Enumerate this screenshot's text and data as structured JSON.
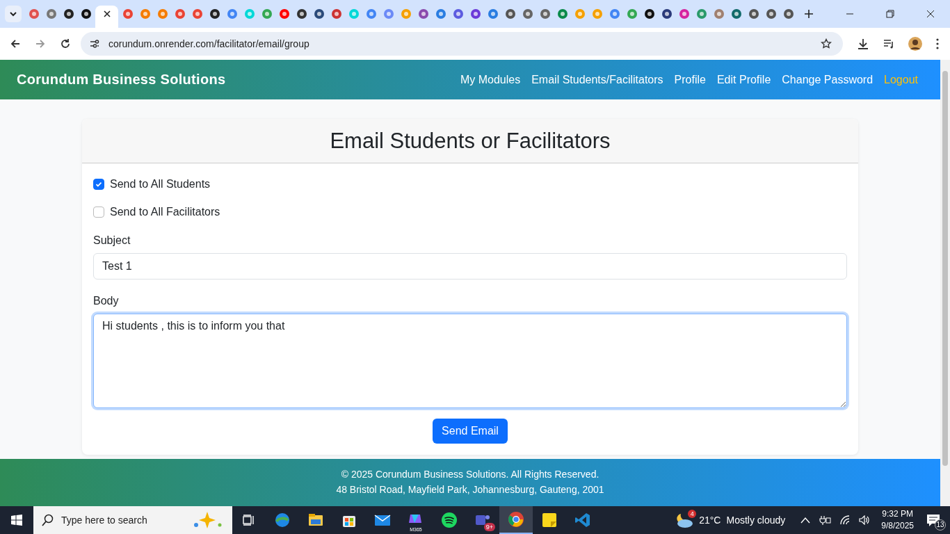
{
  "browser": {
    "tabs": [
      {
        "selected": false
      },
      {
        "selected": false
      },
      {
        "selected": false
      },
      {
        "selected": false
      },
      {
        "selected": true
      },
      {
        "selected": false
      },
      {
        "selected": false
      },
      {
        "selected": false
      },
      {
        "selected": false
      },
      {
        "selected": false
      },
      {
        "selected": false
      },
      {
        "selected": false
      },
      {
        "selected": false
      },
      {
        "selected": false
      },
      {
        "selected": false
      },
      {
        "selected": false
      },
      {
        "selected": false
      },
      {
        "selected": false
      },
      {
        "selected": false
      },
      {
        "selected": false
      },
      {
        "selected": false
      },
      {
        "selected": false
      },
      {
        "selected": false
      },
      {
        "selected": false
      },
      {
        "selected": false
      },
      {
        "selected": false
      },
      {
        "selected": false
      },
      {
        "selected": false
      },
      {
        "selected": false
      },
      {
        "selected": false
      },
      {
        "selected": false
      },
      {
        "selected": false
      },
      {
        "selected": false
      },
      {
        "selected": false
      },
      {
        "selected": false
      },
      {
        "selected": false
      },
      {
        "selected": false
      },
      {
        "selected": false
      },
      {
        "selected": false
      },
      {
        "selected": false
      },
      {
        "selected": false
      },
      {
        "selected": false
      },
      {
        "selected": false
      },
      {
        "selected": false
      }
    ],
    "address": "corundum.onrender.com/facilitator/email/group"
  },
  "navbar": {
    "brand": "Corundum Business Solutions",
    "links": [
      {
        "label": "My Modules",
        "highlighted": false
      },
      {
        "label": "Email Students/Facilitators",
        "highlighted": false
      },
      {
        "label": "Profile",
        "highlighted": false
      },
      {
        "label": "Edit Profile",
        "highlighted": false
      },
      {
        "label": "Change Password",
        "highlighted": false
      },
      {
        "label": "Logout",
        "highlighted": true
      }
    ]
  },
  "card": {
    "title": "Email Students or Facilitators",
    "checkboxes": [
      {
        "label": "Send to All Students",
        "checked": true
      },
      {
        "label": "Send to All Facilitators",
        "checked": false
      }
    ],
    "subject": {
      "label": "Subject",
      "value": "Test 1",
      "focused": false
    },
    "body": {
      "label": "Body",
      "value": "Hi students , this is to inform you that",
      "focused": true
    },
    "button": "Send Email"
  },
  "footer": {
    "lines": [
      "© 2025 Corundum Business Solutions. All Rights Reserved.",
      "48 Bristol Road, Mayfield Park, Johannesburg, Gauteng, 2001"
    ]
  },
  "taskbar": {
    "search_placeholder": "Type here to search",
    "apps": [
      {
        "selected": false
      },
      {
        "selected": false
      },
      {
        "selected": false
      },
      {
        "selected": false
      },
      {
        "selected": false,
        "label": "M365"
      },
      {
        "selected": false
      },
      {
        "selected": false,
        "badge": "9+"
      },
      {
        "selected": true
      },
      {
        "selected": false
      },
      {
        "selected": false
      }
    ],
    "weather": {
      "badge": "4",
      "temperature": "21°C",
      "condition": "Mostly cloudy"
    },
    "time": "9:32 PM",
    "date": "9/8/2025",
    "notifications": "13"
  }
}
